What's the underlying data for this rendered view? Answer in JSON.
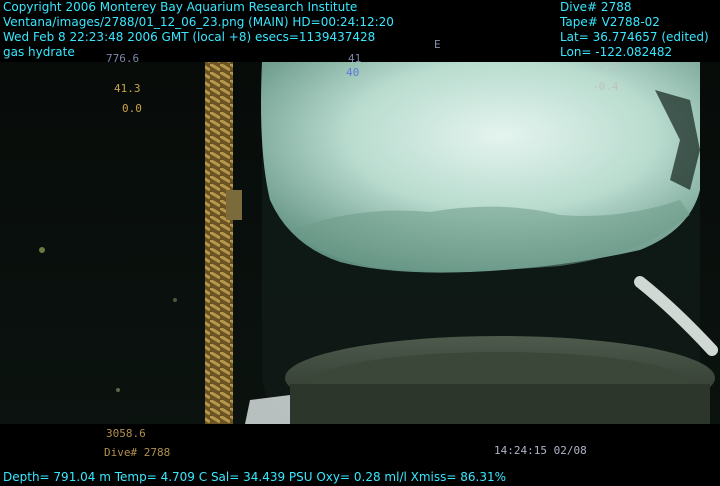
{
  "overlay": {
    "copyright": "Copyright 2006 Monterey Bay Aquarium Research Institute",
    "image_path": "Ventana/images/2788/01_12_06_23.png (MAIN)  HD=00:24:12:20",
    "datetime": "Wed Feb  8 22:23:48 2006 GMT (local +8)  esecs=1139437428",
    "subject": "gas hydrate",
    "dive": "Dive# 2788",
    "tape": "Tape# V2788-02",
    "lat": "Lat= 36.774657 (edited)",
    "lon": "Lon= -122.082482",
    "sensors": "Depth= 791.04 m  Temp= 4.709 C  Sal= 34.439 PSU  Oxy= 0.28 ml/l  Xmiss= 86.31%"
  },
  "camera_hud": {
    "heading": "776.6",
    "pitch": "41.3",
    "roll": "0.0",
    "compass_tick": "41",
    "compass_value": "40",
    "compass_letter": "E",
    "right_top": "-7.1",
    "right_second": "-0.4",
    "bottom_depth": "3058.6",
    "bottom_dive": "Dive# 2788",
    "bottom_time": "14:24:15 02/08"
  },
  "colors": {
    "overlay_text": "#38e8ff",
    "hud_text": "#c9a24a",
    "hud_blue": "#5a7ad8"
  }
}
